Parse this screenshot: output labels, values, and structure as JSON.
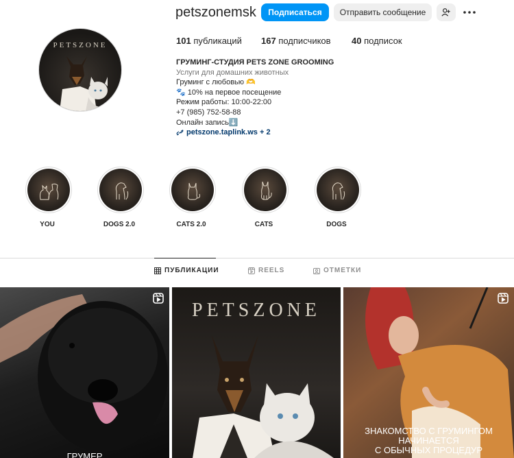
{
  "profile": {
    "username": "petszonemsk",
    "follow_label": "Подписаться",
    "message_label": "Отправить сообщение",
    "stats": {
      "posts_count": "101",
      "posts_label": "публикаций",
      "followers_count": "167",
      "followers_label": "подписчиков",
      "following_count": "40",
      "following_label": "подписок"
    },
    "avatar_logo": "PETSZONE",
    "bio": {
      "name": "ГРУМИНГ-СТУДИЯ PETS ZONE GROOMING",
      "category": "Услуги для домашних животных",
      "lines": [
        "Груминг с любовью 🫶",
        "🐾 10% на первое посещение",
        "Режим работы: 10:00-22:00",
        "+7 (985) 752-58-88",
        "Онлайн запись⬇️"
      ],
      "link": "petszone.taplink.ws + 2"
    }
  },
  "highlights": [
    {
      "label": "YOU",
      "icon": "cat-and-dog-icon"
    },
    {
      "label": "DOGS 2.0",
      "icon": "dog-icon"
    },
    {
      "label": "CATS 2.0",
      "icon": "cat-icon"
    },
    {
      "label": "CATS",
      "icon": "cat-icon"
    },
    {
      "label": "DOGS",
      "icon": "dog-icon"
    }
  ],
  "tabs": [
    {
      "label": "ПУБЛИКАЦИИ",
      "active": true,
      "icon": "grid-icon"
    },
    {
      "label": "REELS",
      "active": false,
      "icon": "reels-icon"
    },
    {
      "label": "ОТМЕТКИ",
      "active": false,
      "icon": "tagged-icon"
    }
  ],
  "posts": [
    {
      "overlay": "ГРУМЕР",
      "reel": true
    },
    {
      "overlay": "PETSZONE",
      "reel": false
    },
    {
      "overlay_lines": [
        "ЗНАКОМСТВО С ГРУМИНГОМ",
        "НАЧИНАЕТСЯ",
        "С ОБЫЧНЫХ ПРОЦЕДУР"
      ],
      "reel": true
    }
  ],
  "colors": {
    "accent": "#0095f6",
    "link": "#00376b",
    "muted": "#737373",
    "border": "#dbdbdb"
  }
}
